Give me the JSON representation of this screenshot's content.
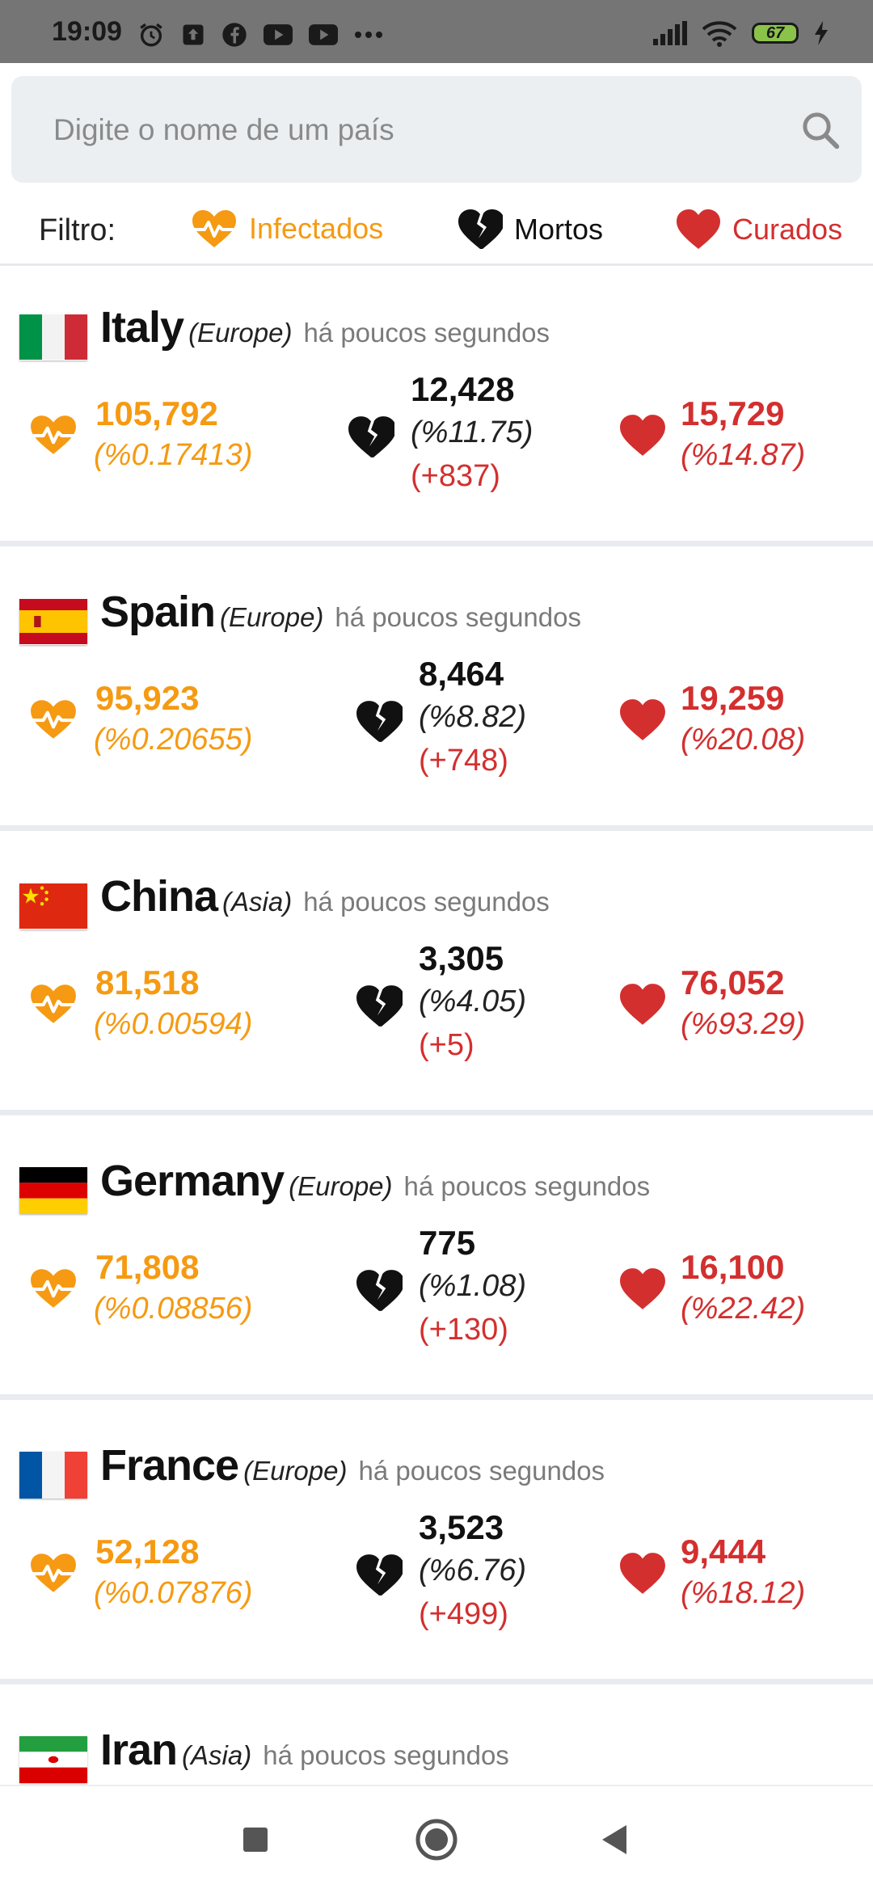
{
  "status_bar": {
    "time": "19:09",
    "battery": "67"
  },
  "search": {
    "placeholder": "Digite o nome de um país",
    "value": ""
  },
  "filter": {
    "label": "Filtro:",
    "infected_label": "Infectados",
    "dead_label": "Mortos",
    "cured_label": "Curados"
  },
  "colors": {
    "infected": "#f59a12",
    "dead": "#111111",
    "cured": "#d32f2f",
    "new_deaths": "#d32f2f"
  },
  "countries": [
    {
      "name": "Italy",
      "continent": "(Europe)",
      "updated": "há poucos segundos",
      "infected": "105,792",
      "infected_pct": "(%0.17413)",
      "deaths": "12,428",
      "deaths_pct": "(%11.75)",
      "deaths_new": "(+837)",
      "cured": "15,729",
      "cured_pct": "(%14.87)"
    },
    {
      "name": "Spain",
      "continent": "(Europe)",
      "updated": "há poucos segundos",
      "infected": "95,923",
      "infected_pct": "(%0.20655)",
      "deaths": "8,464",
      "deaths_pct": "(%8.82)",
      "deaths_new": "(+748)",
      "cured": "19,259",
      "cured_pct": "(%20.08)"
    },
    {
      "name": "China",
      "continent": "(Asia)",
      "updated": "há poucos segundos",
      "infected": "81,518",
      "infected_pct": "(%0.00594)",
      "deaths": "3,305",
      "deaths_pct": "(%4.05)",
      "deaths_new": "(+5)",
      "cured": "76,052",
      "cured_pct": "(%93.29)"
    },
    {
      "name": "Germany",
      "continent": "(Europe)",
      "updated": "há poucos segundos",
      "infected": "71,808",
      "infected_pct": "(%0.08856)",
      "deaths": "775",
      "deaths_pct": "(%1.08)",
      "deaths_new": "(+130)",
      "cured": "16,100",
      "cured_pct": "(%22.42)"
    },
    {
      "name": "France",
      "continent": "(Europe)",
      "updated": "há poucos segundos",
      "infected": "52,128",
      "infected_pct": "(%0.07876)",
      "deaths": "3,523",
      "deaths_pct": "(%6.76)",
      "deaths_new": "(+499)",
      "cured": "9,444",
      "cured_pct": "(%18.12)"
    },
    {
      "name": "Iran",
      "continent": "(Asia)",
      "updated": "há poucos segundos"
    }
  ]
}
